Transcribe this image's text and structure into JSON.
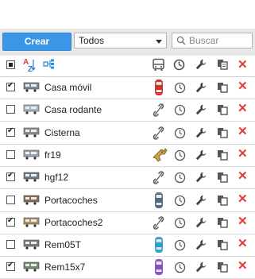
{
  "toolbar": {
    "create_label": "Crear",
    "filter_value": "Todos",
    "search_placeholder": "Buscar"
  },
  "header": {
    "sort_icon_text": "A Z"
  },
  "colors": {
    "accent": "#3a97e8",
    "delete": "#e23b2f"
  },
  "rows": [
    {
      "name": "Casa móvil",
      "checked": true,
      "status": "car-red-icon"
    },
    {
      "name": "Casa rodante",
      "checked": false,
      "status": "unlinked-icon"
    },
    {
      "name": "Cisterna",
      "checked": true,
      "status": "unlinked-icon"
    },
    {
      "name": "fr19",
      "checked": false,
      "status": "gun-icon"
    },
    {
      "name": "hgf12",
      "checked": true,
      "status": "unlinked-icon"
    },
    {
      "name": "Portacoches",
      "checked": false,
      "status": "car-gray-icon"
    },
    {
      "name": "Portacoches2",
      "checked": true,
      "status": "unlinked-icon"
    },
    {
      "name": "Rem05T",
      "checked": false,
      "status": "car-blue-icon"
    },
    {
      "name": "Rem15x7",
      "checked": true,
      "status": "car-purple-icon"
    }
  ]
}
